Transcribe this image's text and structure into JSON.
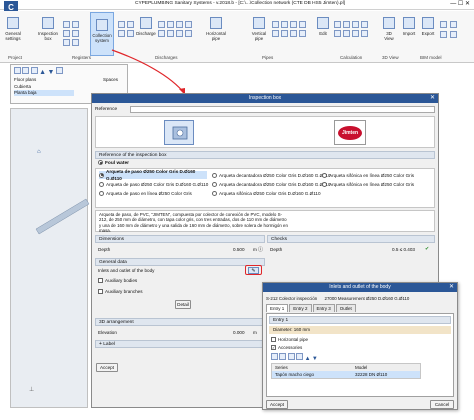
{
  "app": {
    "title": "CYPEPLUMBING Sanitary Systems - v.2018.b - [C:\\...\\Collection network (CTE DB HS5 Jimten).pl]"
  },
  "ribbon": {
    "buttons": [
      {
        "label": "General settings"
      },
      {
        "label": "Inspection box"
      },
      {
        "label": "Collection system"
      },
      {
        "label": "Discharge"
      },
      {
        "label": "Horizontal pipe"
      },
      {
        "label": "Vertical pipe"
      },
      {
        "label": "Edit"
      },
      {
        "label": "3D View"
      },
      {
        "label": "Import"
      },
      {
        "label": "Export"
      }
    ],
    "groups": [
      "Project",
      "Registers",
      "Discharges",
      "Pipes",
      "Calculation",
      "3D View",
      "BIM model"
    ]
  },
  "left_panel": {
    "col1": "Floor plans",
    "col2": "Spaces",
    "items": [
      "Floor plans",
      "Cubierta",
      "Planta baja"
    ]
  },
  "dialog": {
    "title": "Inspection box",
    "reference_label": "Reference",
    "reference_value": "",
    "brand": "Jimten",
    "reference_section": "Reference of the inspection box",
    "foul_water": "Foul water",
    "options": [
      {
        "label": "Arqueta de paso Ø250 Color Gris D.Ø160 G.Ø110",
        "selected": true
      },
      {
        "label": "Arqueta decantadora Ø250 Color Gris D.Ø160 G.Ø110",
        "selected": false
      },
      {
        "label": "Arqueta sifónica en línea Ø250 Color Gris",
        "selected": false
      },
      {
        "label": "Arqueta de paso Ø250 Color Gris D.Ø160 G.Ø110",
        "selected": false
      },
      {
        "label": "Arqueta decantadora Ø250 Color Gris D.Ø160 G.Ø110",
        "selected": false
      },
      {
        "label": "Arqueta sifónica en línea Ø250 Color Gris",
        "selected": false
      },
      {
        "label": "Arqueta de paso en línea Ø250 Color Gris",
        "selected": false
      },
      {
        "label": "Arqueta sifónica Ø250 Color Gris D.Ø160 G.Ø110",
        "selected": false
      }
    ],
    "description": "Arqueta de paso, de PVC, \"JIMTEN\", compuesta por colector de conexión de PVC, modelo S-212, de 250 mm de diámetro, con tapa color gris, con tres entradas, dos de 110 mm de diámetro y una de 160 mm de diámetro y una salida de 160 mm de diámetro, sobre solera de hormigón en masa.",
    "dimensions": {
      "title": "Dimensions",
      "depth_label": "Depth",
      "depth_value": "0.500",
      "depth_unit": "m"
    },
    "checks": {
      "title": "Checks",
      "depth_label": "Depth",
      "depth_value": "0.5 ≤ 0.403"
    },
    "general_data": {
      "title": "General data",
      "inlets_label": "Inlets and outlet of the body",
      "auxiliary_bodies": "Auxiliary bodies",
      "auxiliary_branches": "Auxiliary branches",
      "detail_button": "Detail"
    },
    "arrangement": {
      "title": "3D arrangement",
      "elevation_label": "Elevation",
      "elevation_value": "0.000",
      "elevation_unit": "m"
    },
    "label_section": "Label",
    "accept": "Accept",
    "cancel": "Cancel"
  },
  "sub_dialog": {
    "title": "Inlets and outlet of the body",
    "collector_label": "S-212 Colector inspección",
    "collector_value": "27000 Measurement Ø250 D.Ø160 G.Ø110",
    "tabs": [
      "Entry 1",
      "Entry 2",
      "Entry 3",
      "Outlet"
    ],
    "entry_title": "Entry 1",
    "diameter": "Diameter: 160 mm",
    "horizontal_pipe": "Horizontal pipe",
    "accessories": "Accessories",
    "table_headers": [
      "Series",
      "Model"
    ],
    "table_rows": [
      {
        "series": "Tapón macho ciego",
        "model": "32228 DN Ø110"
      }
    ],
    "accept": "Accept",
    "cancel": "Cancel"
  },
  "colors": {
    "titlebar": "#2b5797",
    "highlight": "#e0262a",
    "selection": "#cde2fa"
  }
}
